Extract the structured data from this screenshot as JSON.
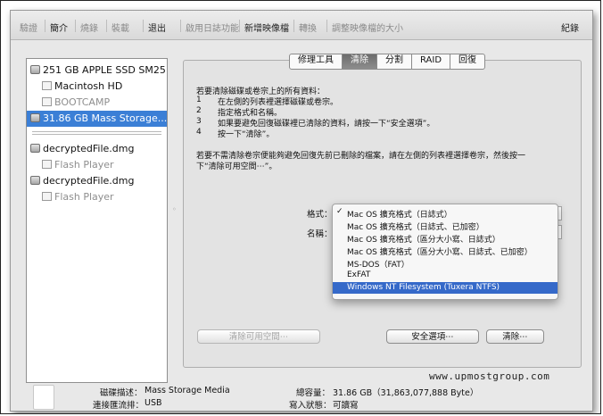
{
  "toolbar": {
    "items": [
      {
        "label": "驗證",
        "disabled": true
      },
      {
        "label": "簡介",
        "disabled": false
      },
      {
        "label": "燒錄",
        "disabled": true
      },
      {
        "label": "裝載",
        "disabled": true
      },
      {
        "label": "退出",
        "disabled": false
      },
      {
        "label": "啟用日誌功能",
        "disabled": true
      },
      {
        "label": "新增映像檔",
        "disabled": false
      },
      {
        "label": "轉換",
        "disabled": true
      },
      {
        "label": "調整映像檔的大小",
        "disabled": true
      }
    ],
    "log_label": "紀錄"
  },
  "sidebar": {
    "items": [
      {
        "label": "251 GB APPLE SSD SM25...",
        "kind": "disk",
        "icon": "internal-disk-icon",
        "dim": false,
        "selected": false
      },
      {
        "label": "Macintosh HD",
        "kind": "volume",
        "icon": "volume-icon",
        "dim": false,
        "selected": false
      },
      {
        "label": "BOOTCAMP",
        "kind": "volume",
        "icon": "volume-icon",
        "dim": true,
        "selected": false
      },
      {
        "label": "31.86 GB Mass Storage...",
        "kind": "disk",
        "icon": "usb-disk-icon",
        "dim": false,
        "selected": true
      },
      {
        "label": "decryptedFile.dmg",
        "kind": "disk",
        "icon": "disk-image-icon",
        "dim": false,
        "selected": false
      },
      {
        "label": "Flash Player",
        "kind": "volume",
        "icon": "volume-icon",
        "dim": true,
        "selected": false
      },
      {
        "label": "decryptedFile.dmg",
        "kind": "disk",
        "icon": "disk-image-icon",
        "dim": false,
        "selected": false
      },
      {
        "label": "Flash Player",
        "kind": "volume",
        "icon": "volume-icon",
        "dim": true,
        "selected": false
      }
    ]
  },
  "tabs": [
    {
      "label": "修理工具",
      "active": false
    },
    {
      "label": "清除",
      "active": true
    },
    {
      "label": "分割",
      "active": false
    },
    {
      "label": "RAID",
      "active": false
    },
    {
      "label": "回復",
      "active": false
    }
  ],
  "instructions": {
    "intro": "若要清除磁碟或卷宗上的所有資料：",
    "steps": [
      {
        "n": "1",
        "text": "在左側的列表裡選擇磁碟或卷宗。"
      },
      {
        "n": "2",
        "text": "指定格式和名稱。"
      },
      {
        "n": "3",
        "text": "如果要避免回復磁碟裡已清除的資料，請按一下“安全選項”。"
      },
      {
        "n": "4",
        "text": "按一下“清除”。"
      }
    ],
    "note_line1": "若要不需清除卷宗便能夠避免回復先前已刪除的檔案，請在左側的列表裡選擇卷宗，然後按一",
    "note_line2": "下“清除可用空間⋯”。"
  },
  "form": {
    "format_label": "格式：",
    "name_label": "名稱："
  },
  "format_menu": {
    "checkmark": "✓",
    "options": [
      {
        "label": "Mac OS 擴充格式（日誌式）",
        "checked": true,
        "highlighted": false
      },
      {
        "label": "Mac OS 擴充格式（日誌式、已加密）",
        "checked": false,
        "highlighted": false
      },
      {
        "label": "Mac OS 擴充格式（區分大小寫、日誌式）",
        "checked": false,
        "highlighted": false
      },
      {
        "label": "Mac OS 擴充格式（區分大小寫、日誌式、已加密）",
        "checked": false,
        "highlighted": false
      },
      {
        "label": "MS-DOS（FAT）",
        "checked": false,
        "highlighted": false
      },
      {
        "label": "ExFAT",
        "checked": false,
        "highlighted": false
      },
      {
        "label": "Windows NT Filesystem (Tuxera NTFS)",
        "checked": false,
        "highlighted": true
      }
    ]
  },
  "buttons": {
    "erase_free_space": "清除可用空間⋯",
    "security_options": "安全選項⋯",
    "erase": "清除⋯"
  },
  "info": {
    "desc_label": "磁碟描述：",
    "desc_value": "Mass Storage Media",
    "conn_label": "連接匯流排：",
    "conn_value": "USB",
    "cap_label": "總容量：",
    "cap_value": "31.86 GB（31,863,077,888 Byte）",
    "write_label": "寫入狀態：",
    "write_value": "可讀寫"
  },
  "watermark": "www.upmostgroup.com",
  "colors": {
    "selection": "#3b7fd6",
    "menu_highlight": "#3569c9"
  }
}
